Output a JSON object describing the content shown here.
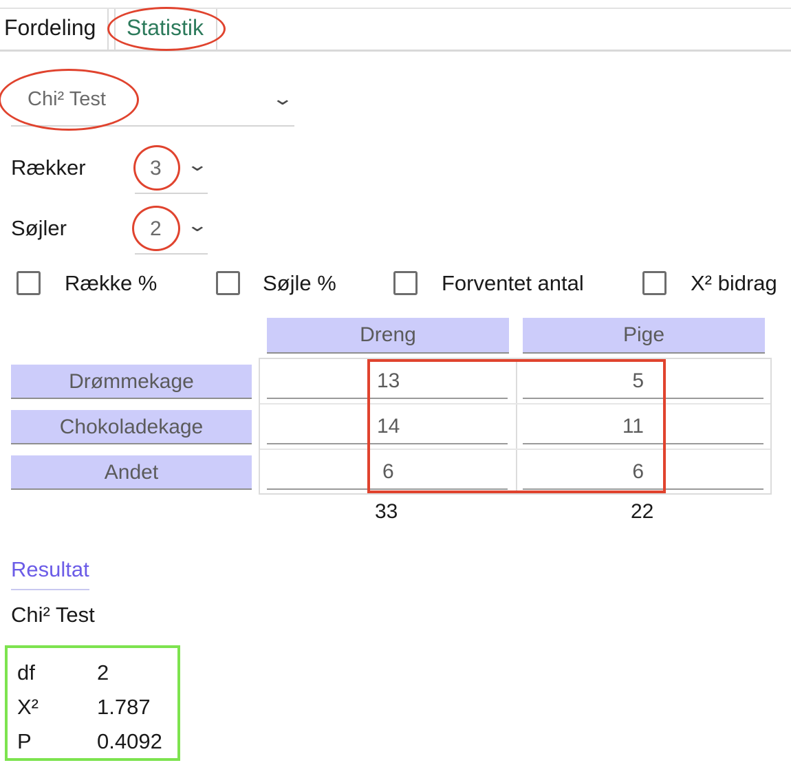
{
  "tabs": [
    {
      "label": "Fordeling"
    },
    {
      "label": "Statistik"
    }
  ],
  "test_select": {
    "value": "Chi² Test"
  },
  "rows_field": {
    "label": "Rækker",
    "value": "3"
  },
  "cols_field": {
    "label": "Søjler",
    "value": "2"
  },
  "options": [
    {
      "label": "Række %",
      "checked": false
    },
    {
      "label": "Søjle %",
      "checked": false
    },
    {
      "label": "Forventet antal",
      "checked": false
    },
    {
      "label": "X² bidrag",
      "checked": false
    }
  ],
  "table": {
    "columns": [
      "Dreng",
      "Pige"
    ],
    "rows": [
      "Drømmekage",
      "Chokoladekage",
      "Andet"
    ],
    "values": [
      [
        "13",
        "5"
      ],
      [
        "14",
        "11"
      ],
      [
        "6",
        "6"
      ]
    ],
    "column_totals": [
      "33",
      "22"
    ]
  },
  "result": {
    "title": "Resultat",
    "test_name": "Chi² Test",
    "stats": [
      {
        "key": "df",
        "value": "2"
      },
      {
        "key": "X²",
        "value": "1.787"
      },
      {
        "key": "P",
        "value": "0.4092"
      }
    ]
  },
  "colors": {
    "active_tab": "#2c7a5b",
    "header_fill": "#ccccfa",
    "annotation_red": "#e0432e",
    "annotation_green": "#7de34f",
    "result_title": "#6b5ce7"
  }
}
